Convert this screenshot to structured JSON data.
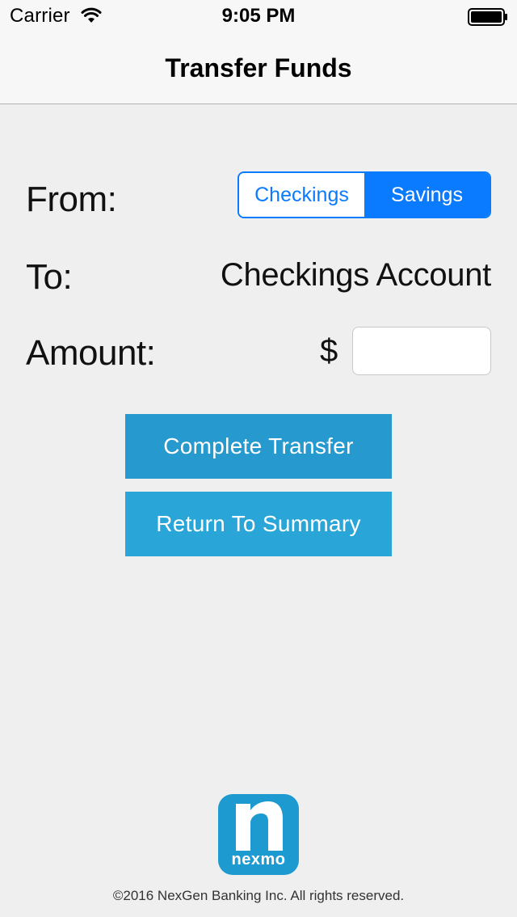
{
  "status_bar": {
    "carrier": "Carrier",
    "time": "9:05 PM",
    "wifi_icon": "wifi-icon",
    "battery_icon": "battery-icon"
  },
  "nav": {
    "title": "Transfer Funds"
  },
  "form": {
    "from_label": "From:",
    "from_options": [
      "Checkings",
      "Savings"
    ],
    "from_selected": "Savings",
    "to_label": "To:",
    "to_value": "Checkings Account",
    "amount_label": "Amount:",
    "currency_symbol": "$",
    "amount_value": "",
    "amount_placeholder": ""
  },
  "buttons": {
    "complete": "Complete Transfer",
    "return": "Return To Summary"
  },
  "logo": {
    "text": "nexmo"
  },
  "footer": {
    "copyright": "©2016 NexGen Banking Inc. All rights reserved."
  },
  "colors": {
    "accent": "#0a7aff",
    "button_primary": "#2699cf",
    "button_secondary": "#29a5d8",
    "logo_bg": "#1d9bd1",
    "background": "#efefef"
  }
}
